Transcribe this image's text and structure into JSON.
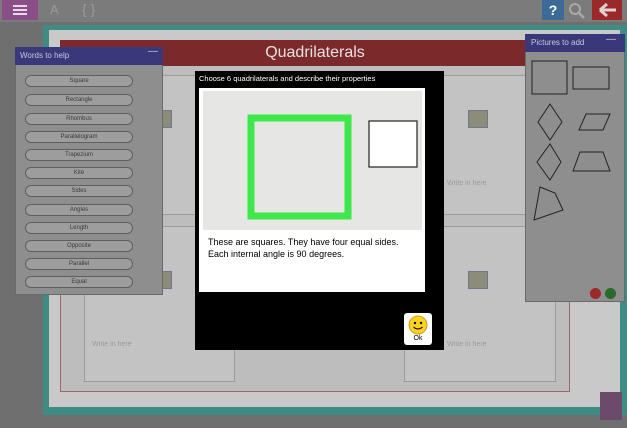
{
  "toolbar": {
    "menu_icon": "hamburger-menu-icon",
    "text_tool_label": "A",
    "brace_tool_label": "{ }",
    "help_label": "?",
    "search_icon": "magnifier-icon",
    "back_icon": "back-arrow-icon"
  },
  "worksheet": {
    "title": "Quadrilaterals",
    "write_here": [
      "Write in here",
      "Write in here",
      "Write in here"
    ]
  },
  "words_panel": {
    "title": "Words to help",
    "minimize_label": "—",
    "words": [
      "Square",
      "Rectangle",
      "Rhombus",
      "Parallelogram",
      "Trapezium",
      "Kite",
      "Sides",
      "Angles",
      "Length",
      "Opposite",
      "Parallel",
      "Equal"
    ]
  },
  "pictures_panel": {
    "title": "Pictures to add",
    "minimize_label": "—",
    "shapes": [
      "square",
      "rectangle",
      "rhombus",
      "parallelogram",
      "kite",
      "trapezium",
      "irregular-quadrilateral"
    ],
    "delete_icon": "remove-icon",
    "add_icon": "add-icon"
  },
  "modal": {
    "title": "Choose 6 quadrilaterals and describe their properties",
    "description": "These are squares. They have four equal sides. Each internal angle is 90 degrees.",
    "ok_label": "Ok",
    "ok_icon": "smiley-face-icon"
  },
  "colors": {
    "accent_purple": "#8a4f86",
    "teal": "#3f8c85",
    "title_red": "#7a2a2a",
    "panel_navy": "#39387a",
    "square_green": "#3fe84a"
  },
  "trash_icon": "trash-can-icon"
}
